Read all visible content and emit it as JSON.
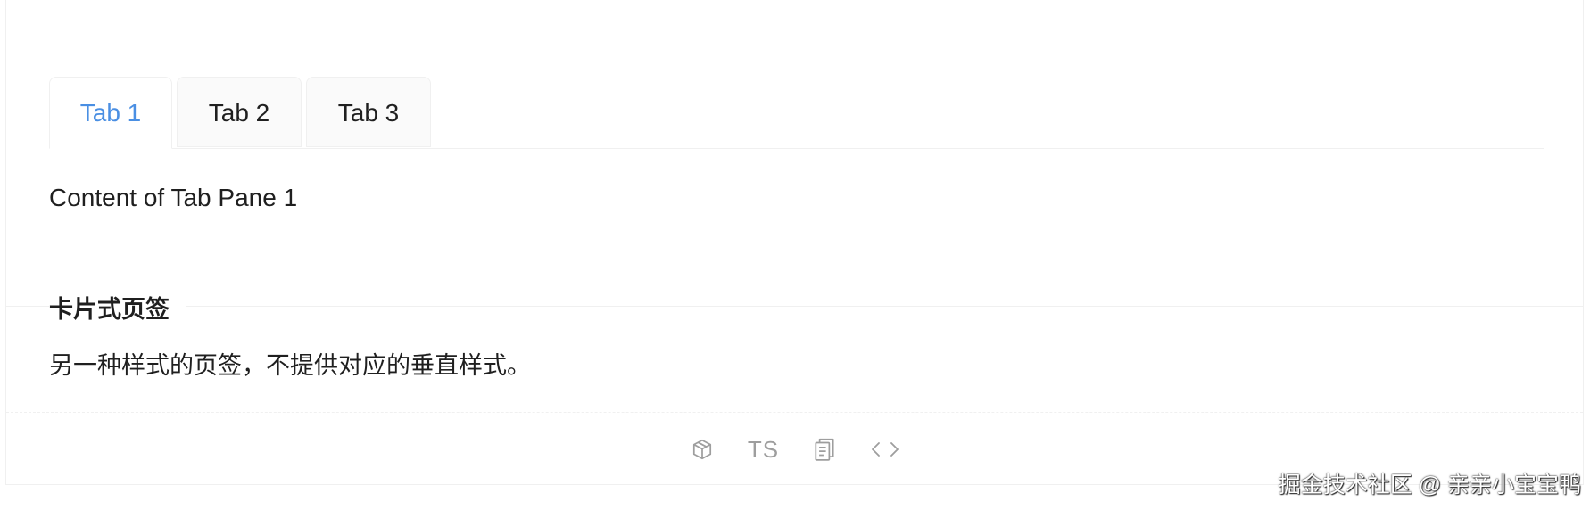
{
  "tabs": [
    {
      "label": "Tab 1",
      "active": true
    },
    {
      "label": "Tab 2",
      "active": false
    },
    {
      "label": "Tab 3",
      "active": false
    }
  ],
  "active_pane": {
    "content": "Content of Tab Pane 1"
  },
  "section": {
    "title": "卡片式页签",
    "description": "另一种样式的页签，不提供对应的垂直样式。"
  },
  "actions": {
    "codesandbox_icon": "cube-icon",
    "ts_label": "TS",
    "copy_icon": "copy-icon",
    "code_icon": "code-icon"
  },
  "watermark": "掘金技术社区 @ 亲亲小宝宝鸭",
  "colors": {
    "accent": "#4a8fe3",
    "border": "#f0f0f0",
    "icon": "#9e9e9e"
  }
}
